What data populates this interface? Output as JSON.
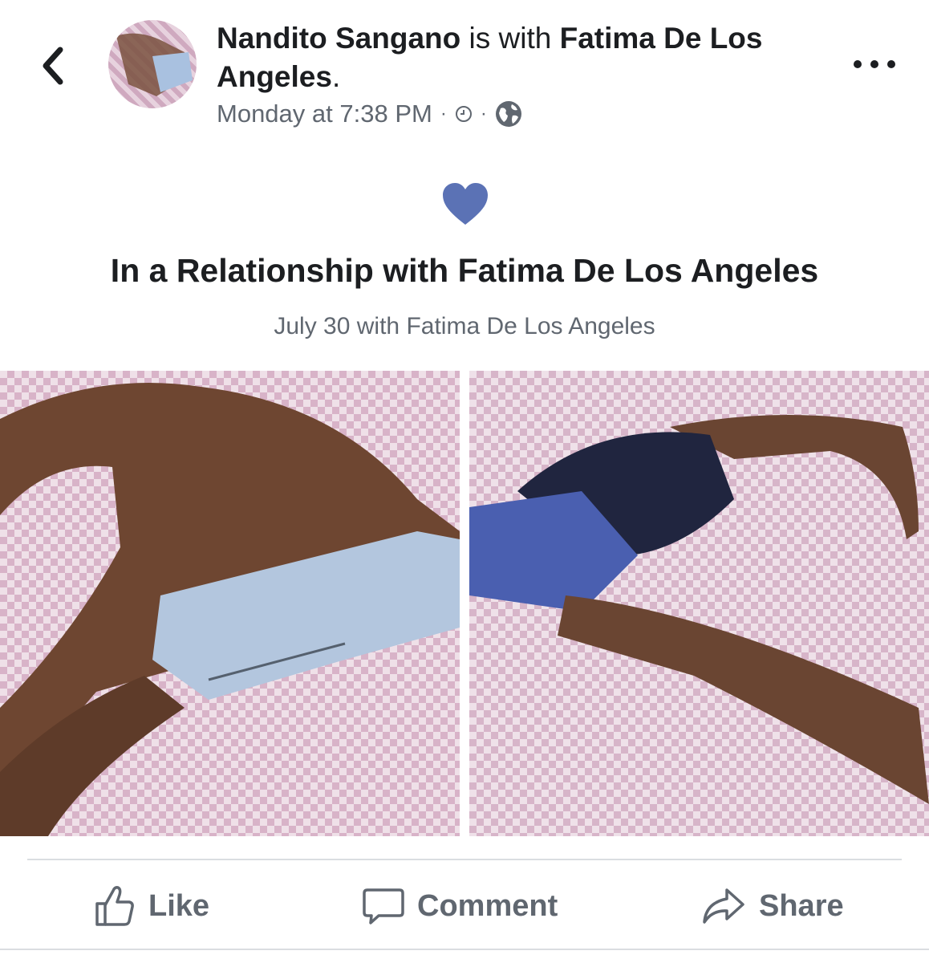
{
  "header": {
    "back_icon": "chevron-left-icon",
    "author": "Nandito Sangano",
    "connector": " is with ",
    "tagged": "Fatima De Los Angeles",
    "period": ".",
    "time": "Monday at 7:38 PM",
    "separator": "·",
    "clock_icon": "clock-icon",
    "privacy_icon": "globe-icon",
    "more_icon": "more-options-icon"
  },
  "life_event": {
    "icon": "heart-icon",
    "heart_color": "#5b72b5",
    "title": "In a Relationship with Fatima De Los Angeles",
    "subtitle": "July 30 with Fatima De Los Angeles"
  },
  "photos": [
    {
      "name": "photo-left"
    },
    {
      "name": "photo-right"
    }
  ],
  "actions": {
    "like_label": "Like",
    "comment_label": "Comment",
    "share_label": "Share"
  },
  "colors": {
    "text_primary": "#1c1e21",
    "text_secondary": "#606770",
    "divider": "#dadde1"
  }
}
